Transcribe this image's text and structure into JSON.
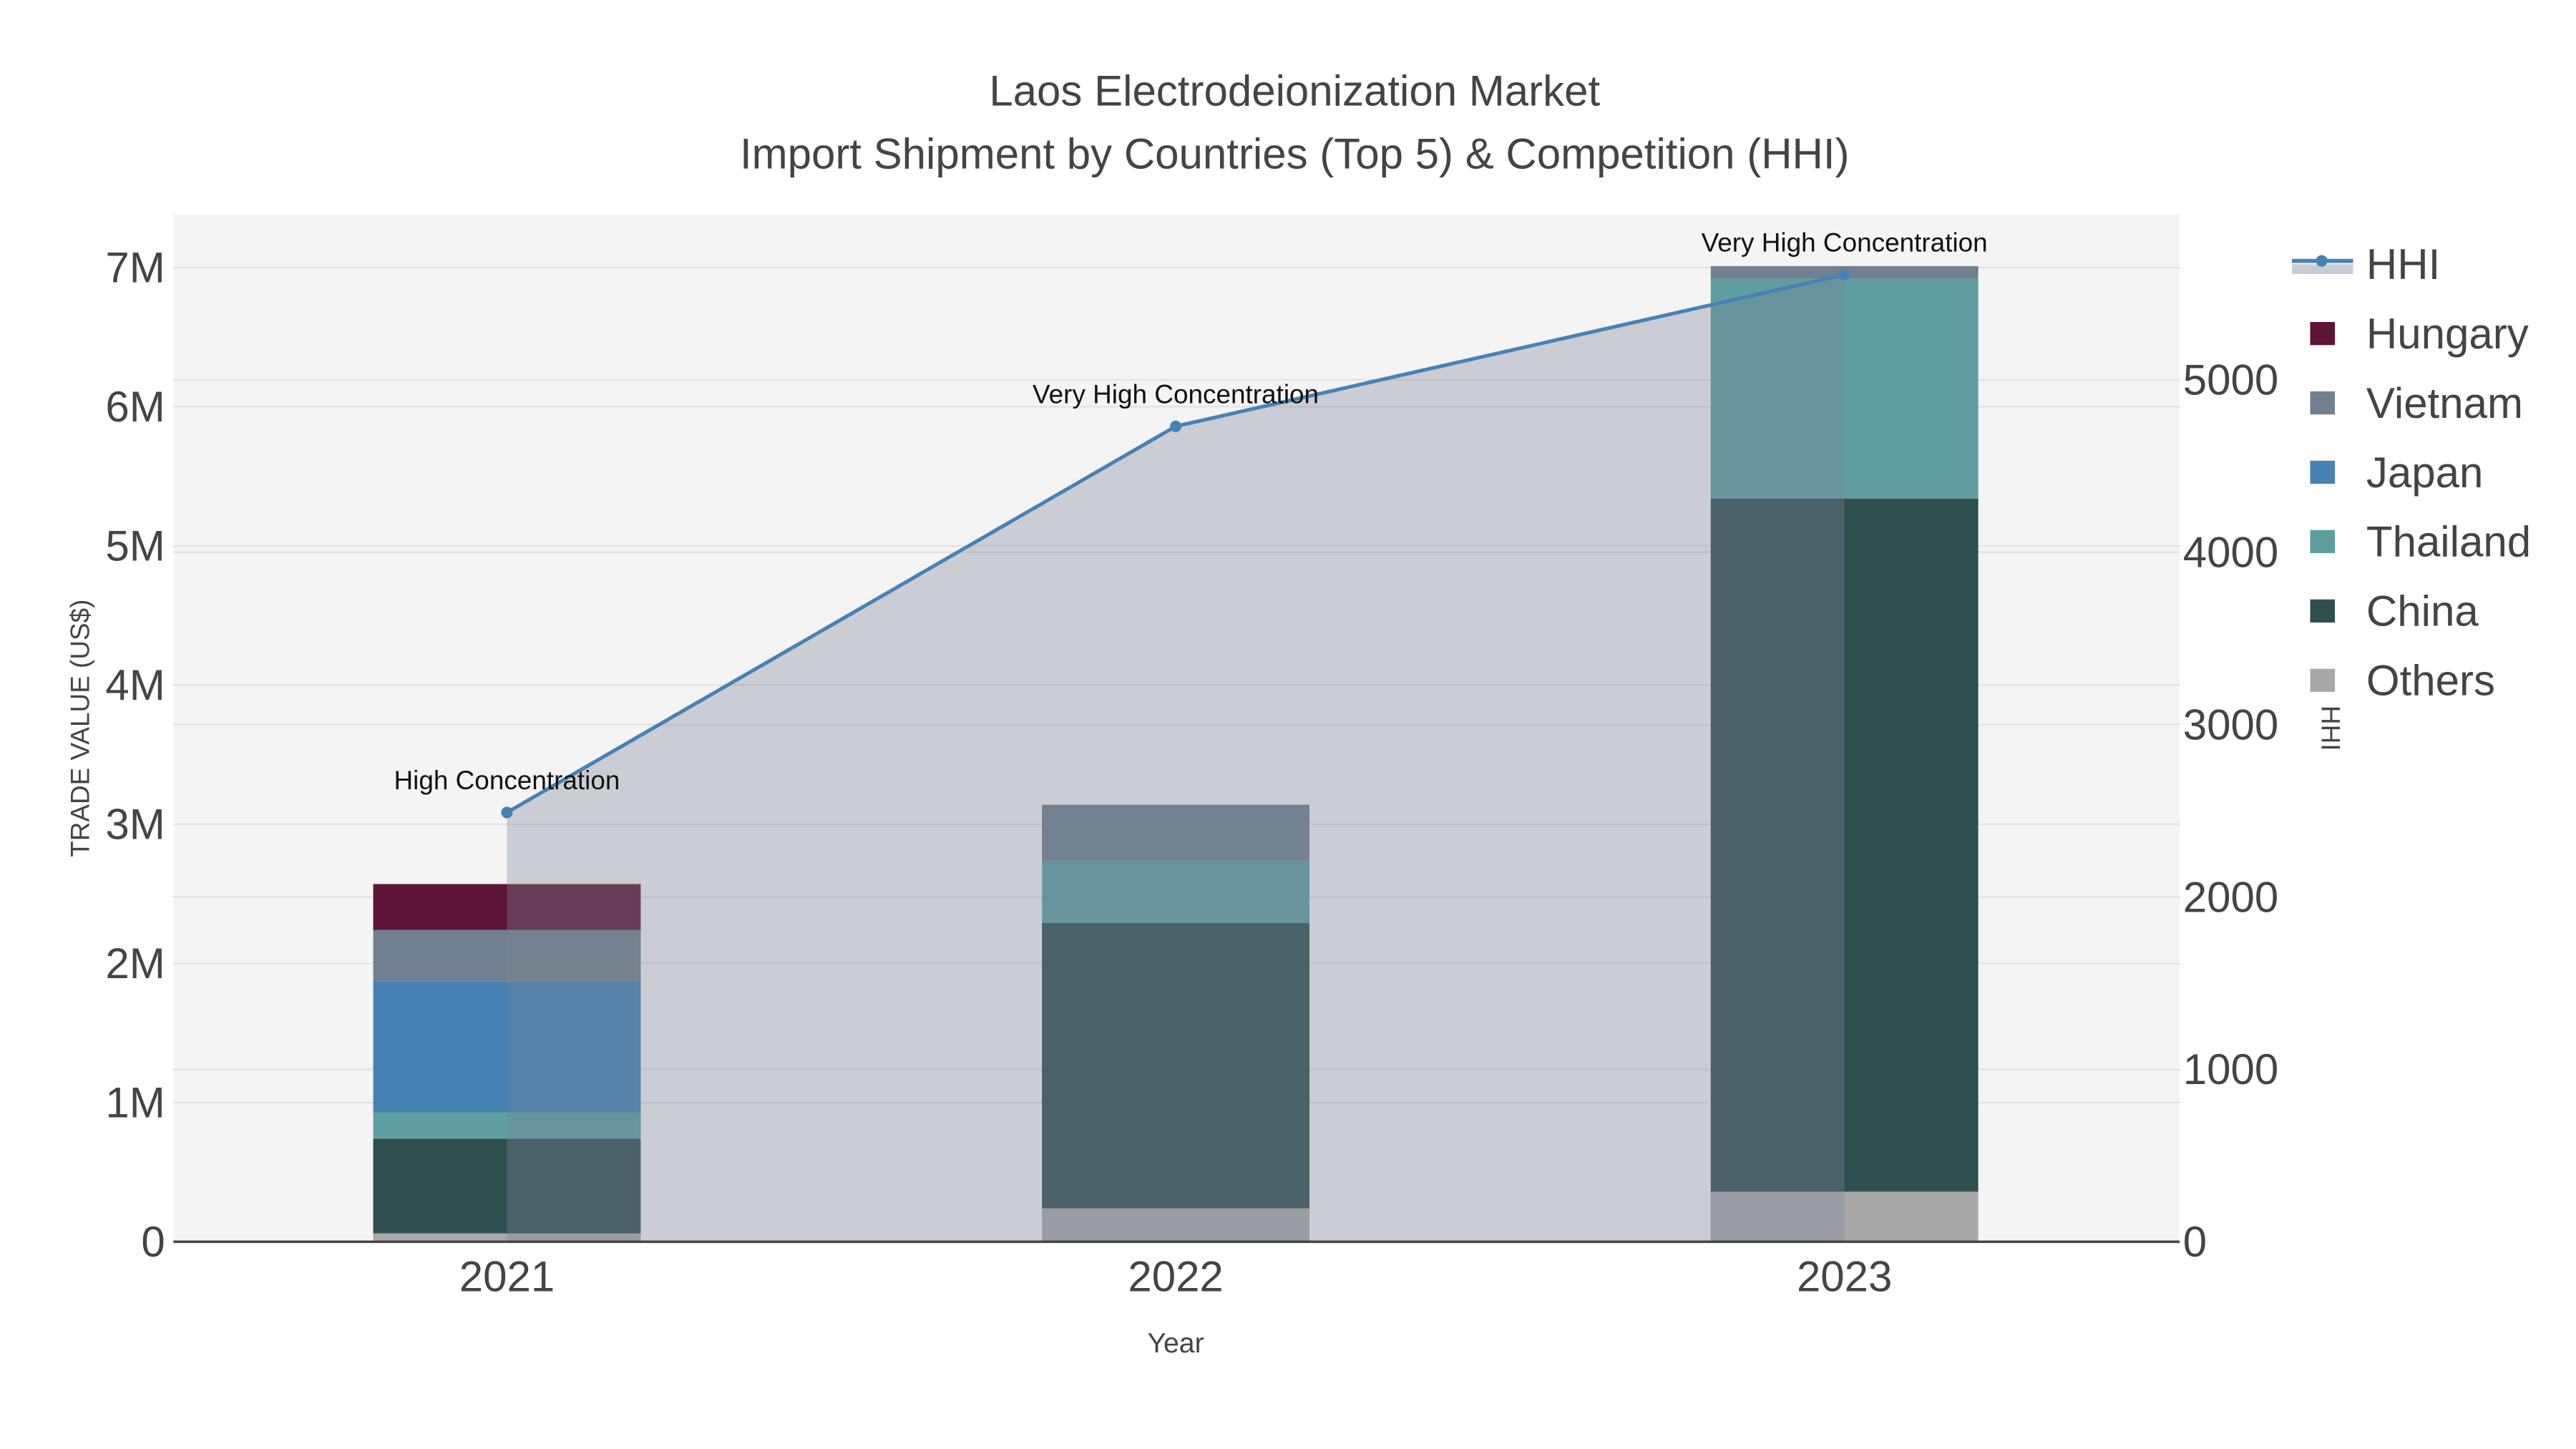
{
  "chart_data": {
    "type": "bar",
    "title_line1": "Laos Electrodeionization Market",
    "title_line2": "Import Shipment by Countries (Top 5) & Competition (HHI)",
    "xlabel": "Year",
    "ylabel": "TRADE VALUE (US$)",
    "y2label": "HHI",
    "categories": [
      "2021",
      "2022",
      "2023"
    ],
    "ylim": [
      0,
      7400000
    ],
    "y_ticks": [
      0,
      1000000,
      2000000,
      3000000,
      4000000,
      5000000,
      6000000,
      7000000
    ],
    "y_tick_labels": [
      "0",
      "1M",
      "2M",
      "3M",
      "4M",
      "5M",
      "6M",
      "7M"
    ],
    "y2lim": [
      0,
      5950
    ],
    "y2_ticks": [
      0,
      1000,
      2000,
      3000,
      4000,
      5000
    ],
    "y2_tick_labels": [
      "0",
      "1000",
      "2000",
      "3000",
      "4000",
      "5000"
    ],
    "series": [
      {
        "name": "Others",
        "color": "#a9a9a9",
        "values": [
          60000,
          240000,
          360000
        ]
      },
      {
        "name": "China",
        "color": "#2f4f4f",
        "values": [
          680000,
          2050000,
          4980000
        ]
      },
      {
        "name": "Thailand",
        "color": "#5f9ea0",
        "values": [
          190000,
          450000,
          1580000
        ]
      },
      {
        "name": "Japan",
        "color": "#4682b4",
        "values": [
          940000,
          0,
          0
        ]
      },
      {
        "name": "Vietnam",
        "color": "#708090",
        "values": [
          370000,
          400000,
          90000
        ]
      },
      {
        "name": "Hungary",
        "color": "#5e1436",
        "values": [
          330000,
          0,
          0
        ]
      }
    ],
    "hhi": {
      "name": "HHI",
      "color": "#4682b4",
      "values": [
        2490,
        4730,
        5610
      ]
    },
    "annotations": [
      "High Concentration",
      "Very High Concentration",
      "Very High Concentration"
    ],
    "legend": [
      "HHI",
      "Hungary",
      "Vietnam",
      "Japan",
      "Thailand",
      "China",
      "Others"
    ],
    "legend_position": "right"
  }
}
